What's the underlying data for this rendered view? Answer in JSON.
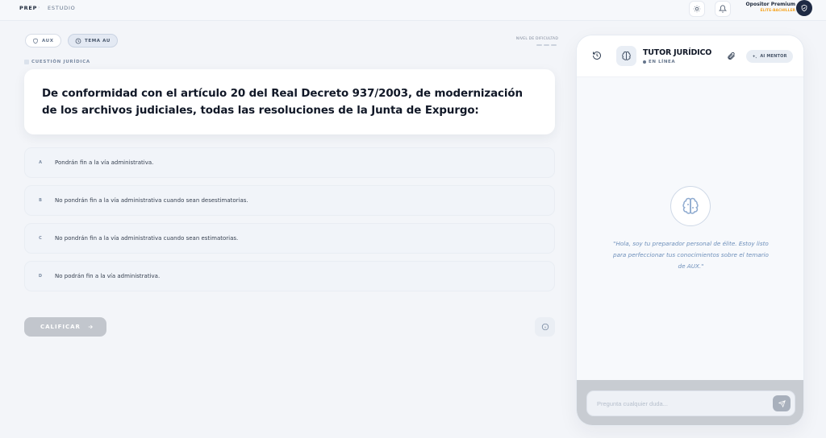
{
  "nav": {
    "brand": "PREP",
    "separator": "›",
    "crumb": "ESTUDIO",
    "user_name": "Opositor Premium",
    "user_role": "ÉLITE-BACHILLER"
  },
  "chips": [
    {
      "label": "AUX",
      "icon": "shield-icon",
      "active": false
    },
    {
      "label": "TEMA AU",
      "icon": "clock-icon",
      "active": true
    }
  ],
  "difficulty_label": "NIVEL DE DIFICULTAD",
  "section_label": "CUESTIÓN JURÍDICA",
  "question": "De conformidad con el artículo 20 del Real Decreto 937/2003, de modernización de los archivos judiciales, todas las resoluciones de la Junta de Expurgo:",
  "options": [
    {
      "letter": "A",
      "text": "Pondrán fin a la vía administrativa."
    },
    {
      "letter": "B",
      "text": "No pondrán fin a la vía administrativa cuando sean desestimatorias."
    },
    {
      "letter": "C",
      "text": "No pondrán fin a la vía administrativa cuando sean estimatorias."
    },
    {
      "letter": "D",
      "text": "No podrán fin a la vía administrativa."
    }
  ],
  "submit_label": "CALIFICAR",
  "tutor": {
    "title": "TUTOR JURÍDICO",
    "status": "EN LÍNEA",
    "mentor_label": "AI MENTOR",
    "welcome": "\"Hola, soy tu preparador personal de élite. Estoy listo para perfeccionar tus conocimientos sobre el temario de AUX.\"",
    "input_placeholder": "Pregunta cualquier duda..."
  },
  "icons": [
    "sun-icon",
    "bell-icon",
    "crest-icon",
    "shield-icon",
    "clock-icon",
    "arrow-right-icon",
    "info-icon",
    "history-icon",
    "brain-icon",
    "paperclip-icon",
    "sparkles-icon",
    "send-icon"
  ],
  "colors": {
    "accent": "#1e2a44",
    "role": "#f5a524",
    "welcome_text": "#6d8fba",
    "submit_disabled": "#c2c6cd"
  }
}
